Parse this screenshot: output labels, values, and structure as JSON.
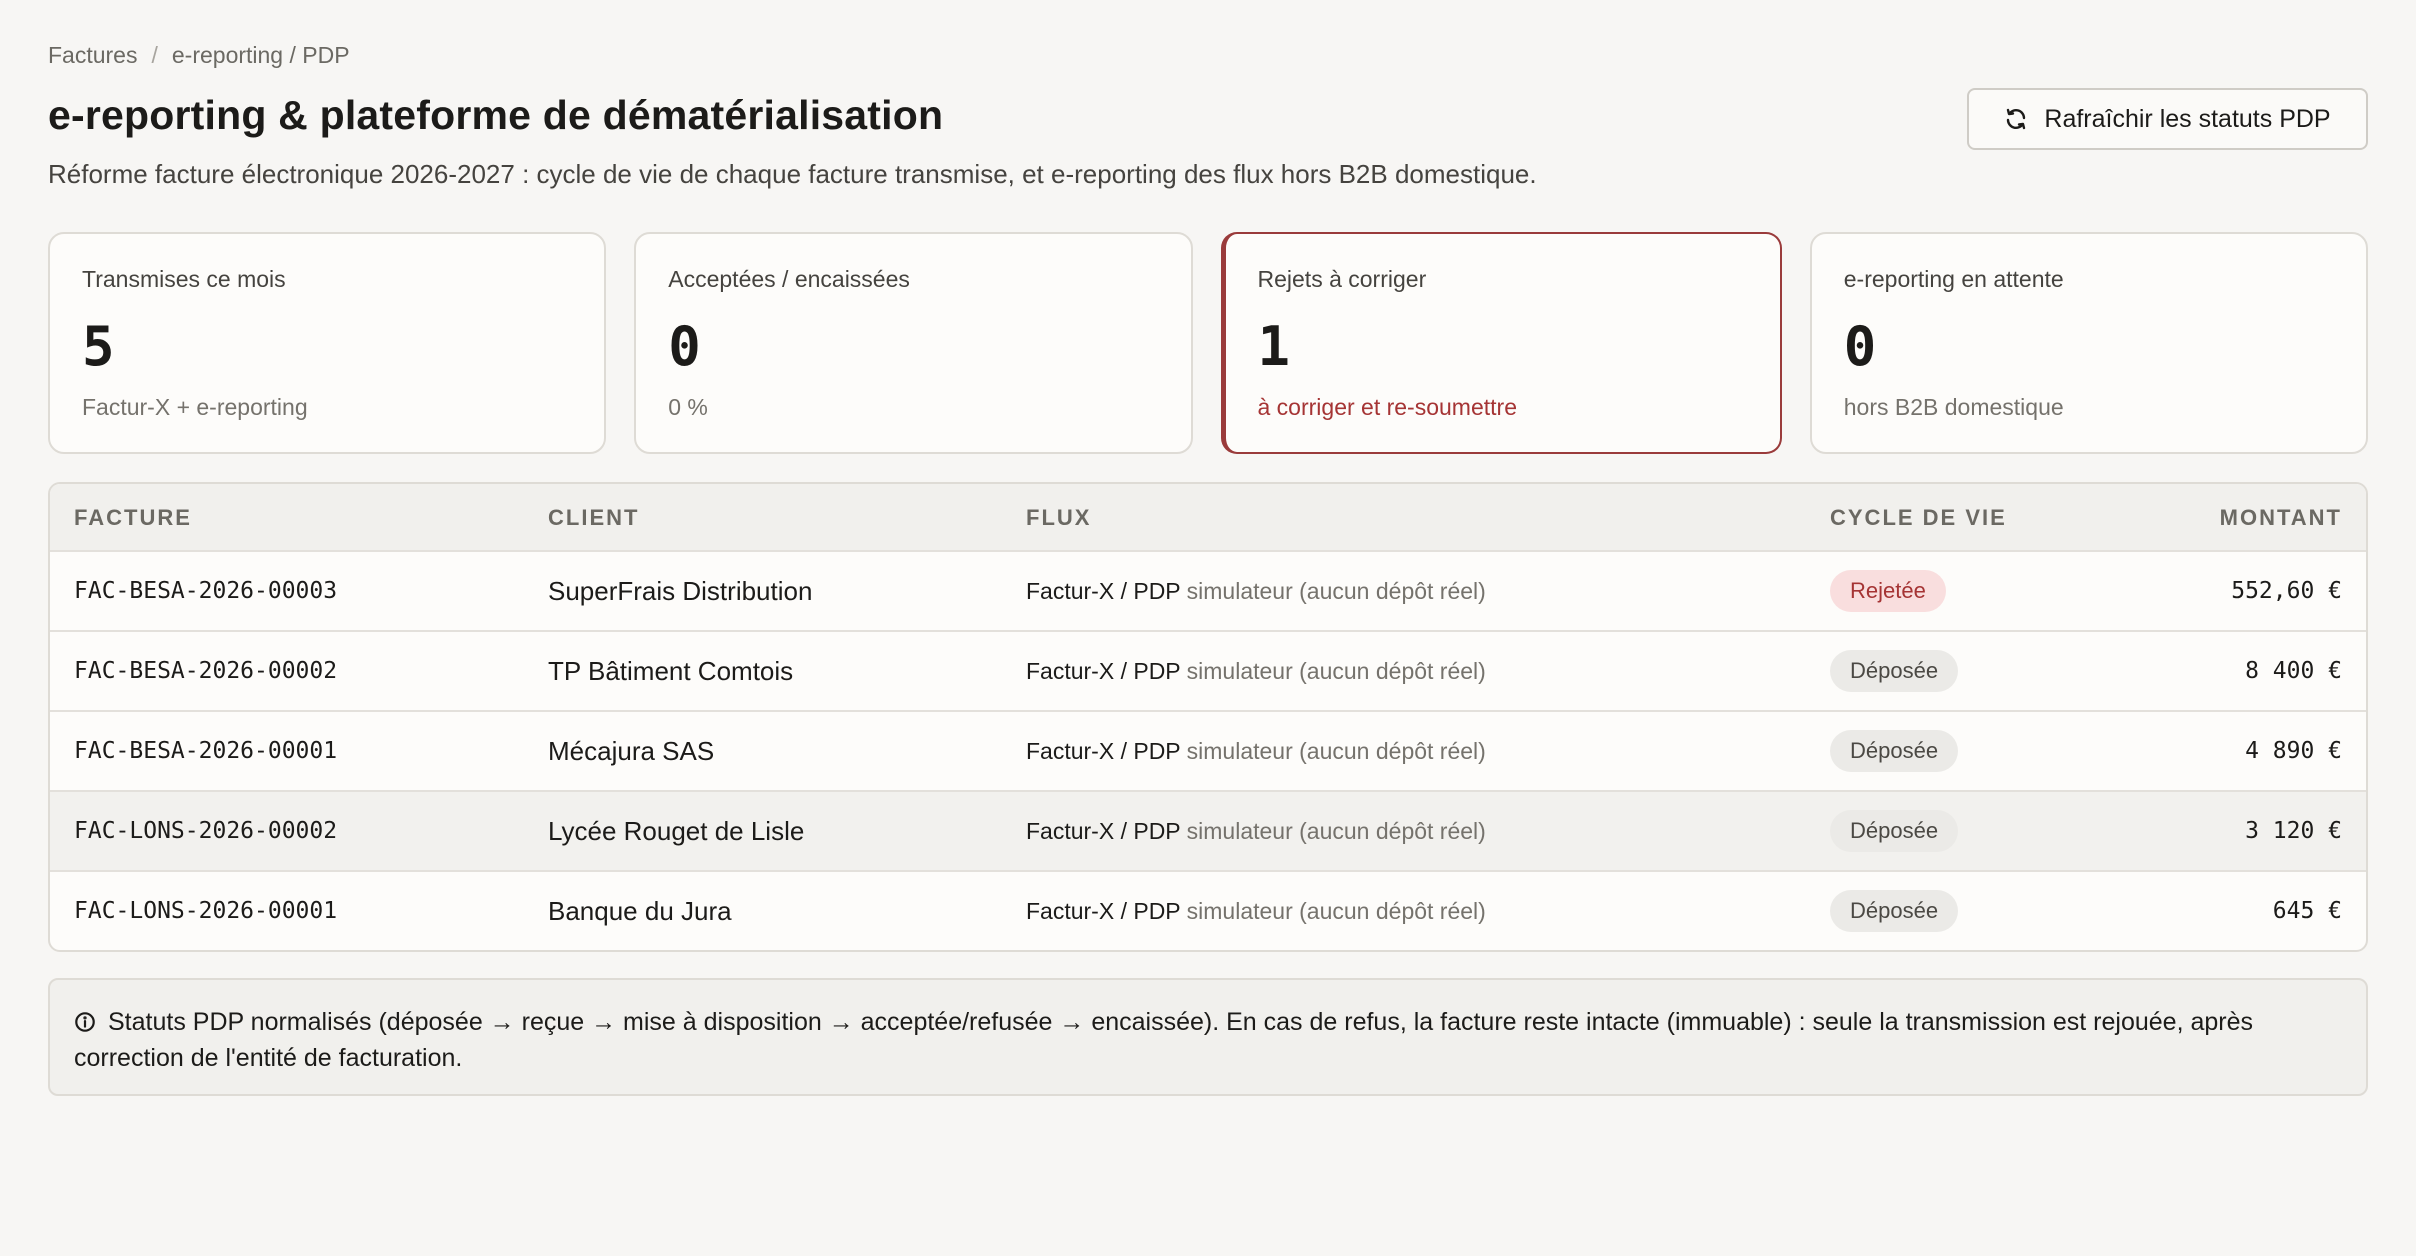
{
  "breadcrumb": {
    "root": "Factures",
    "separator": "/",
    "current": "e-reporting / PDP"
  },
  "header": {
    "title": "e-reporting & plateforme de dématérialisation",
    "subtitle": "Réforme facture électronique 2026-2027 : cycle de vie de chaque facture transmise, et e-reporting des flux hors B2B domestique.",
    "refresh_label": "Rafraîchir les statuts PDP"
  },
  "cards": [
    {
      "label": "Transmises ce mois",
      "value": "5",
      "note": "Factur-X + e-reporting"
    },
    {
      "label": "Acceptées / encaissées",
      "value": "0",
      "note": "0 %"
    },
    {
      "label": "Rejets à corriger",
      "value": "1",
      "note": "à corriger et re-soumettre"
    },
    {
      "label": "e-reporting en attente",
      "value": "0",
      "note": "hors B2B domestique"
    }
  ],
  "table": {
    "headers": {
      "invoice": "FACTURE",
      "client": "CLIENT",
      "flow": "FLUX",
      "lifecycle": "CYCLE DE VIE",
      "amount": "MONTANT"
    },
    "rows": [
      {
        "invoice": "FAC-BESA-2026-00003",
        "client": "SuperFrais Distribution",
        "flow": "Factur-X / PDP",
        "flow_note": "simulateur (aucun dépôt réel)",
        "status": "Rejetée",
        "amount": "552,60 €"
      },
      {
        "invoice": "FAC-BESA-2026-00002",
        "client": "TP Bâtiment Comtois",
        "flow": "Factur-X / PDP",
        "flow_note": "simulateur (aucun dépôt réel)",
        "status": "Déposée",
        "amount": "8 400 €"
      },
      {
        "invoice": "FAC-BESA-2026-00001",
        "client": "Mécajura SAS",
        "flow": "Factur-X / PDP",
        "flow_note": "simulateur (aucun dépôt réel)",
        "status": "Déposée",
        "amount": "4 890 €"
      },
      {
        "invoice": "FAC-LONS-2026-00002",
        "client": "Lycée Rouget de Lisle",
        "flow": "Factur-X / PDP",
        "flow_note": "simulateur (aucun dépôt réel)",
        "status": "Déposée",
        "amount": "3 120 €"
      },
      {
        "invoice": "FAC-LONS-2026-00001",
        "client": "Banque du Jura",
        "flow": "Factur-X / PDP",
        "flow_note": "simulateur (aucun dépôt réel)",
        "status": "Déposée",
        "amount": "645 €"
      }
    ]
  },
  "info": {
    "icon": "info-circle-icon",
    "text": "Statuts PDP normalisés (déposée → reçue → mise à disposition → acceptée/refusée → encaissée). En cas de refus, la facture reste intacte (immuable) : seule la transmission est rejouée, après correction de l'entité de facturation."
  },
  "colors": {
    "accent_alert": "#9a3b3b",
    "rejected_bg": "#f9dede",
    "rejected_text": "#a53434",
    "deposited_bg": "#ebeae7"
  }
}
